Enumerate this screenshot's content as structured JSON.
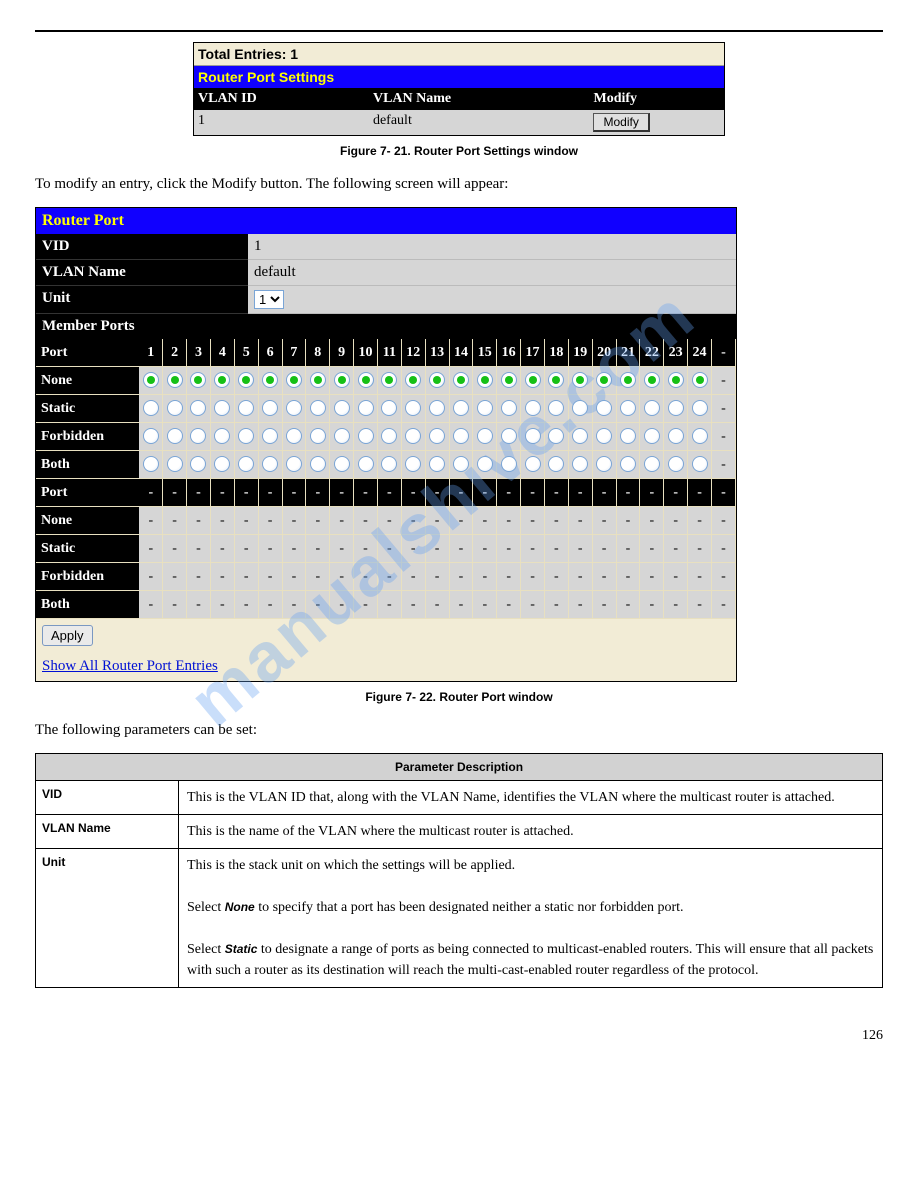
{
  "fig1": {
    "total_label": "Total Entries: 1",
    "title": "Router Port Settings",
    "col1": "VLAN ID",
    "col2": "VLAN Name",
    "col3": "Modify",
    "data_vid": "1",
    "data_name": "default",
    "modify_btn": "Modify"
  },
  "caption1": "Figure 7- 21. Router Port Settings window",
  "instr_line": "To modify an entry, click the Modify button. The following screen will appear:",
  "fig2": {
    "title": "Router Port",
    "vid_label": "VID",
    "vid_value": "1",
    "vlan_label": "VLAN Name",
    "vlan_value": "default",
    "unit_label": "Unit",
    "unit_value": "1",
    "member_label": "Member Ports",
    "port_row": "Port",
    "port_nums": [
      "1",
      "2",
      "3",
      "4",
      "5",
      "6",
      "7",
      "8",
      "9",
      "10",
      "11",
      "12",
      "13",
      "14",
      "15",
      "16",
      "17",
      "18",
      "19",
      "20",
      "21",
      "22",
      "23",
      "24",
      "-"
    ],
    "row_none": "None",
    "row_static": "Static",
    "row_forbidden": "Forbidden",
    "row_both": "Both",
    "apply_btn": "Apply",
    "show_link": "Show All Router Port Entries"
  },
  "caption2": "Figure 7- 22. Router Port window",
  "paramintro": "The following parameters can be set:",
  "paramtable": {
    "head": "Parameter Description",
    "r1l": "VID",
    "r1r": "This is the VLAN ID that, along with the VLAN Name, identifies the VLAN where the multicast router is attached.",
    "r2l": "VLAN Name",
    "r2r": "This is the name of the VLAN where the multicast router is attached.",
    "r3l": "Unit",
    "r3r_line1": "This is the stack unit on which the settings will be applied.",
    "r3r_line2": "Select None to specify that a port has been designated neither a static nor forbidden port.",
    "r3r_line3": "Select Static to designate a range of ports as being connected to multicast-enabled routers. This will ensure that all packets with such a router as its destination will reach the multi-cast-enabled router regardless of the protocol.",
    "em_none": "None",
    "em_static": "Static"
  },
  "pagenum": "126",
  "watermark": "manualshive.com"
}
